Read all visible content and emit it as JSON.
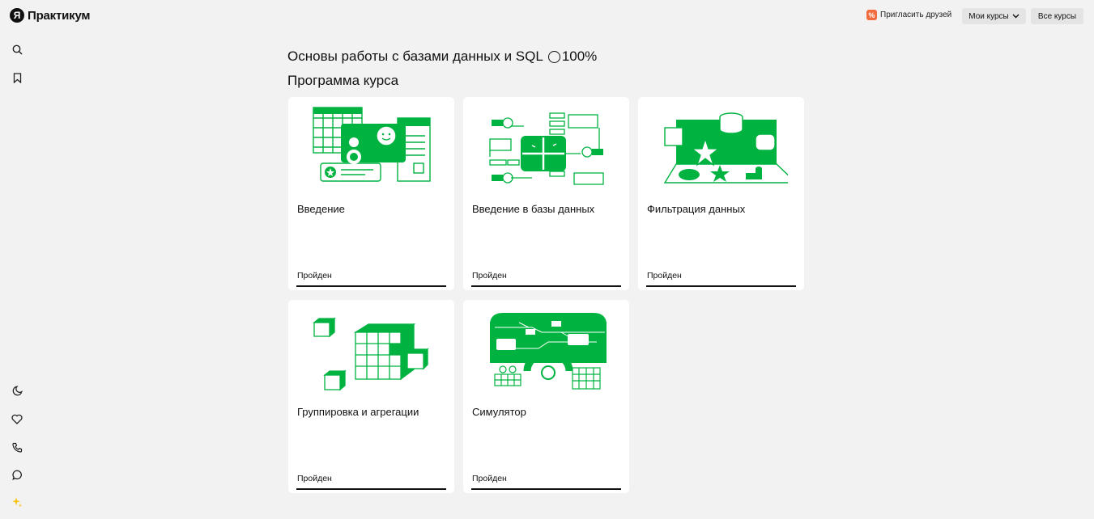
{
  "header": {
    "logo_letter": "Я",
    "logo_text": "Практикум",
    "invite_label": "Пригласить друзей",
    "my_courses_label": "Мои курсы",
    "all_courses_label": "Все курсы"
  },
  "sidebar": {
    "icons": [
      "search-icon",
      "bookmark-icon",
      "moon-icon",
      "heart-icon",
      "phone-icon",
      "chat-icon",
      "sparkle-icon"
    ]
  },
  "course": {
    "title": "Основы работы с базами данных и SQL",
    "progress": "100%",
    "program_label": "Программа курса"
  },
  "modules": [
    {
      "title": "Введение",
      "status": "Пройден"
    },
    {
      "title": "Введение в базы данных",
      "status": "Пройден"
    },
    {
      "title": "Фильтрация данных",
      "status": "Пройден"
    },
    {
      "title": "Группировка и агрегации",
      "status": "Пройден"
    },
    {
      "title": "Симулятор",
      "status": "Пройден"
    }
  ],
  "colors": {
    "accent": "#00b341",
    "invite_badge": "#f36a3c",
    "background": "#f2f2f2"
  }
}
